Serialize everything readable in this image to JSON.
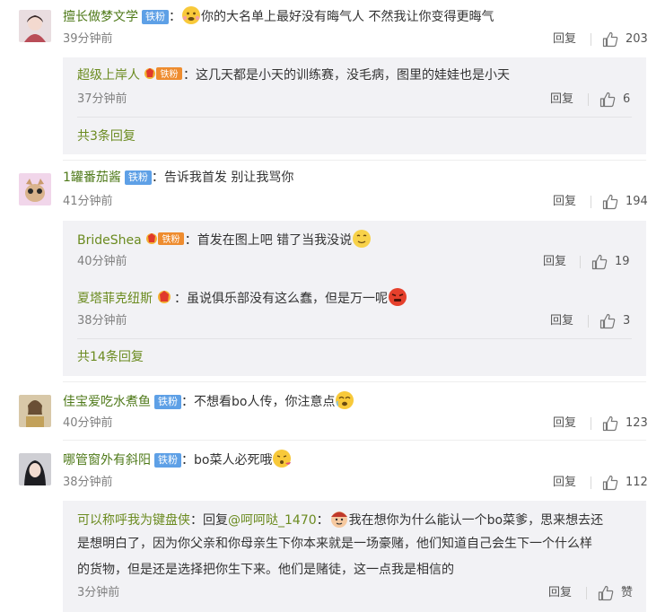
{
  "comments": [
    {
      "user": "擅长做梦文学",
      "badge": "铁粉",
      "text": "你的大名单上最好没有晦气人 不然我让你变得更晦气",
      "time": "39分钟前",
      "reply_label": "回复",
      "likes": "203",
      "replies": [
        {
          "user": "超级上岸人",
          "badge": "铁粉",
          "text": "这几天都是小天的训练赛，没毛病，图里的娃娃也是小天",
          "time": "37分钟前",
          "reply_label": "回复",
          "likes": "6"
        }
      ],
      "more": "共3条回复"
    },
    {
      "user": "1罐番茄酱",
      "badge": "铁粉",
      "text": "告诉我首发 别让我骂你",
      "time": "41分钟前",
      "reply_label": "回复",
      "likes": "194",
      "replies": [
        {
          "user": "BrideShea",
          "badge": "铁粉",
          "text": "首发在图上吧 错了当我没说",
          "time": "40分钟前",
          "reply_label": "回复",
          "likes": "19"
        },
        {
          "user": "夏塔菲克纽斯",
          "text": "虽说俱乐部没有这么蠢，但是万一呢",
          "time": "38分钟前",
          "reply_label": "回复",
          "likes": "3"
        }
      ],
      "more": "共14条回复"
    },
    {
      "user": "佳宝爱吃水煮鱼",
      "badge": "铁粉",
      "text": "不想看bo人传，你注意点",
      "time": "40分钟前",
      "reply_label": "回复",
      "likes": "123"
    },
    {
      "user": "哪管窗外有斜阳",
      "badge": "铁粉",
      "text": "bo菜人必死哦",
      "time": "38分钟前",
      "reply_label": "回复",
      "likes": "112",
      "replies": [
        {
          "user": "可以称呼我为键盘侠",
          "reply_prefix": "回复",
          "mention": "@呵呵哒_1470",
          "text_line1": "我在想你为什么能认一个bo菜爹，思来想去还",
          "text_line2": "是想明白了，因为你父亲和你母亲生下你本来就是一场豪赌，他们知道自己会生下一个什么样",
          "text_line3": "的货物，但是还是选择把你生下来。他们是赌徒，这一点我是相信的",
          "time": "3分钟前",
          "reply_label": "回复",
          "likes": "赞"
        }
      ]
    }
  ],
  "colors": {
    "username": "#6b8b20",
    "badge": "#5ea0e6",
    "sub_bg": "#f2f2f5"
  },
  "icons": [
    "thumbs-up-icon",
    "emoji-icon",
    "avatar"
  ]
}
